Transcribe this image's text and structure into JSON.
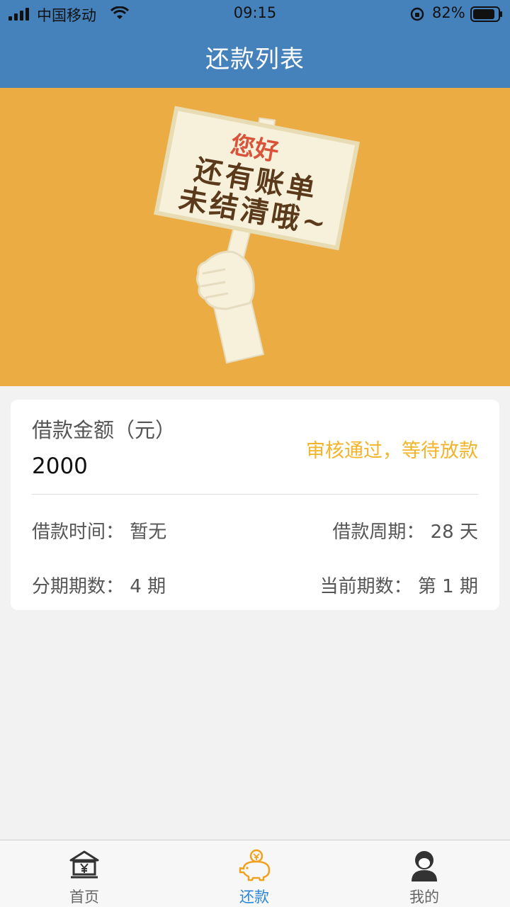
{
  "status_bar": {
    "carrier": "中国移动",
    "time": "09:15",
    "battery": "82%"
  },
  "header": {
    "title": "还款列表"
  },
  "banner": {
    "greeting": "您好",
    "line1": "还有账单",
    "line2": "未结清哦~",
    "colors": {
      "background": "#ebad43",
      "sign": "#f7f1dc",
      "greeting": "#d9533b",
      "text": "#5b3a1c"
    }
  },
  "loan_card": {
    "amount_label": "借款金额（元）",
    "amount_value": "2000",
    "status": "审核通过，等待放款",
    "loan_time": "借款时间：  暂无",
    "loan_period": "借款周期：  28 天",
    "installments": "分期期数：  4 期",
    "current_period": "当前期数：  第 1 期"
  },
  "tabbar": {
    "tabs": [
      {
        "label": "首页",
        "icon": "bank-yen-icon",
        "active": false
      },
      {
        "label": "还款",
        "icon": "piggy-bank-icon",
        "active": true
      },
      {
        "label": "我的",
        "icon": "user-icon",
        "active": false
      }
    ]
  },
  "colors": {
    "header": "#4582bc",
    "status_accent": "#f2b42a",
    "tab_active": "#2b86d6"
  }
}
